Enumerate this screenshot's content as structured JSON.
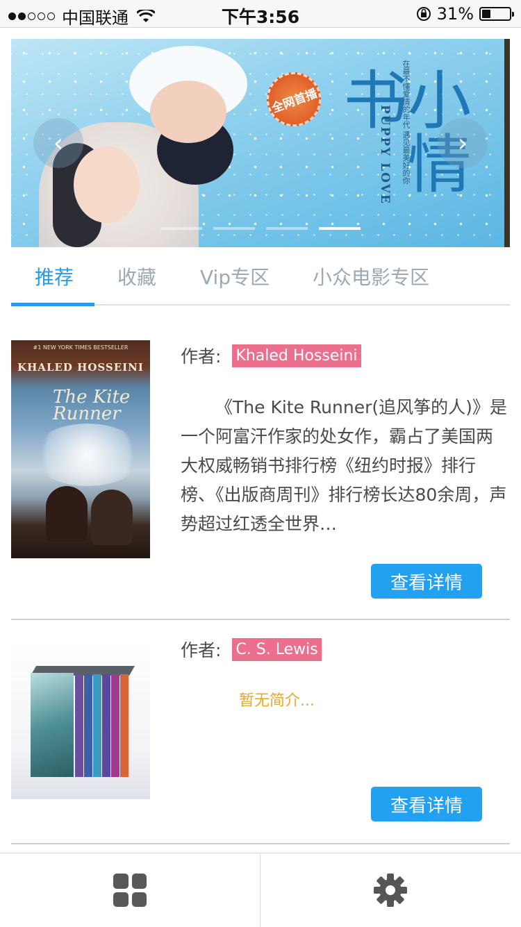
{
  "status_bar": {
    "carrier": "中国联通",
    "time": "下午3:56",
    "battery_percent": "31%",
    "battery_level": 0.31
  },
  "banner": {
    "badge": "全网首播",
    "title_cn": "小情书",
    "title_en": "PUPPY LOVE",
    "tagline": "在最不懂爱情的年代 遇见最美好的你",
    "prev_label": "‹",
    "next_label": "›",
    "slide_count": 4,
    "active_slide": 4
  },
  "tabs": [
    {
      "label": "推荐",
      "active": true
    },
    {
      "label": "收藏",
      "active": false
    },
    {
      "label": "Vip专区",
      "active": false
    },
    {
      "label": "小众电影专区",
      "active": false
    }
  ],
  "books": [
    {
      "author_label": "作者:",
      "author": "Khaled Hosseini",
      "cover_top": "#1 NEW YORK TIMES BESTSELLER",
      "cover_author": "KHALED HOSSEINI",
      "cover_title": "The Kite Runner",
      "description": "《The Kite Runner(追风筝的人)》是一个阿富汗作家的处女作，霸占了美国两大权威畅销书排行榜《纽约时报》排行榜、《出版商周刊》排行榜长达80余周，声势超过红透全世界…",
      "button": "查看详情"
    },
    {
      "author_label": "作者:",
      "author": "C. S. Lewis",
      "description": "暂无简介...",
      "button": "查看详情"
    }
  ],
  "bottom_bar": {
    "left_icon": "grid-icon",
    "right_icon": "gear-icon"
  },
  "colors": {
    "accent": "#2a9ae8",
    "button": "#23a1f1",
    "author_tag": "#ec6f8e",
    "empty_desc": "#e5a829"
  }
}
